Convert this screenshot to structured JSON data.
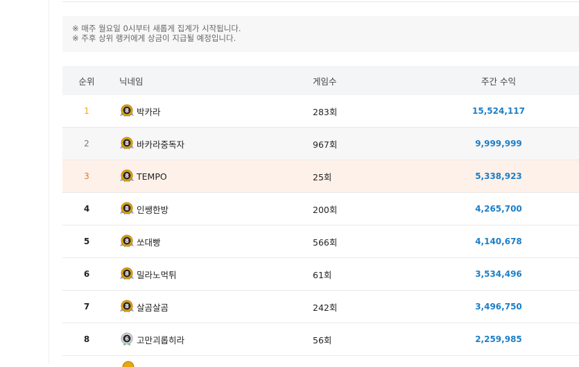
{
  "notice": {
    "line1": "※ 매주 월요일 0시부터 새롭게 집계가 시작됩니다.",
    "line2": "※ 주후 상위 랭커에게 상금이 지급될 예정입니다."
  },
  "table": {
    "headers": {
      "rank": "순위",
      "nickname": "닉네임",
      "games": "게임수",
      "profit": "주간 수익"
    },
    "rows": [
      {
        "rank": "1",
        "level": "8",
        "nickname": "박카라",
        "games": "283회",
        "profit": "15,524,117"
      },
      {
        "rank": "2",
        "level": "8",
        "nickname": "바카라중독자",
        "games": "967회",
        "profit": "9,999,999"
      },
      {
        "rank": "3",
        "level": "8",
        "nickname": "TEMPO",
        "games": "25회",
        "profit": "5,338,923"
      },
      {
        "rank": "4",
        "level": "8",
        "nickname": "인쌩한방",
        "games": "200회",
        "profit": "4,265,700"
      },
      {
        "rank": "5",
        "level": "8",
        "nickname": "쏘대빵",
        "games": "566회",
        "profit": "4,140,678"
      },
      {
        "rank": "6",
        "level": "8",
        "nickname": "밀라노먹튀",
        "games": "61회",
        "profit": "3,534,496"
      },
      {
        "rank": "7",
        "level": "8",
        "nickname": "살곰살곰",
        "games": "242회",
        "profit": "3,496,750"
      },
      {
        "rank": "8",
        "level": "6",
        "nickname": "고만괴롭히라",
        "games": "56회",
        "profit": "2,259,985"
      }
    ]
  },
  "colors": {
    "profit": "#1c7ec7",
    "gold": "#f0a30a",
    "bronze": "#e0782a",
    "third_row_bg": "#fdf1ea"
  },
  "icons": {
    "level_badge_gold": "gold-medal-level-icon",
    "level_badge_silver": "silver-medal-level-icon"
  }
}
